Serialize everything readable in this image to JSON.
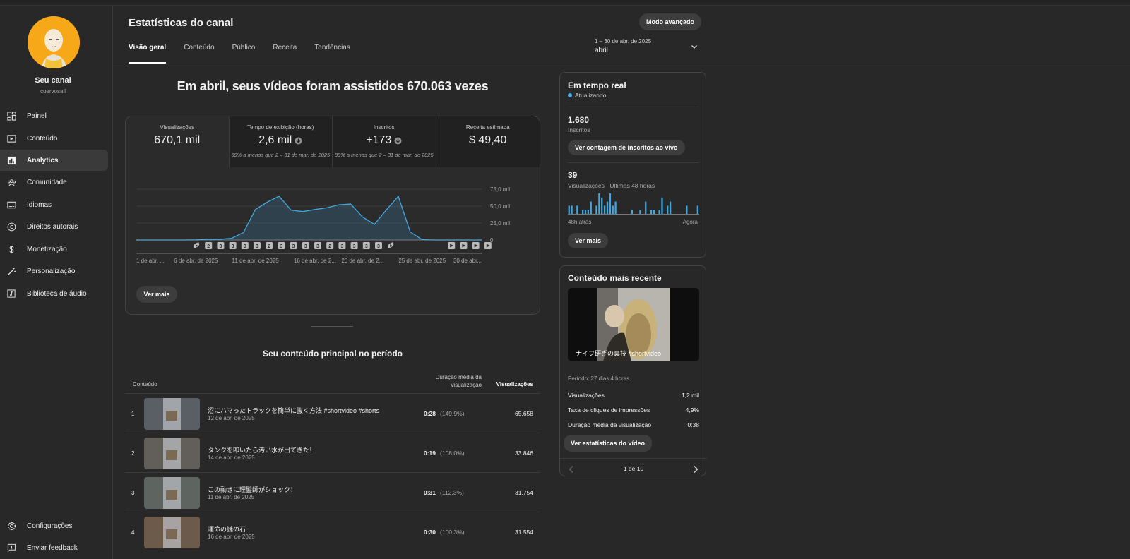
{
  "sidebar": {
    "channel_name": "Seu canal",
    "channel_handle": "cuervosail",
    "items": [
      {
        "label": "Painel",
        "icon": "dashboard-icon"
      },
      {
        "label": "Conteúdo",
        "icon": "content-icon"
      },
      {
        "label": "Analytics",
        "icon": "analytics-icon",
        "active": true
      },
      {
        "label": "Comunidade",
        "icon": "community-icon"
      },
      {
        "label": "Idiomas",
        "icon": "subtitles-icon"
      },
      {
        "label": "Direitos autorais",
        "icon": "copyright-icon"
      },
      {
        "label": "Monetização",
        "icon": "dollar-icon"
      },
      {
        "label": "Personalização",
        "icon": "magic-wand-icon"
      },
      {
        "label": "Biblioteca de áudio",
        "icon": "audio-library-icon"
      }
    ],
    "bottom_items": [
      {
        "label": "Configurações",
        "icon": "gear-icon"
      },
      {
        "label": "Enviar feedback",
        "icon": "feedback-icon"
      }
    ]
  },
  "header": {
    "title": "Estatísticas do canal",
    "advanced_button": "Modo avançado",
    "tabs": [
      "Visão geral",
      "Conteúdo",
      "Público",
      "Receita",
      "Tendências"
    ],
    "date_range": "1 – 30 de abr. de 2025",
    "date_value": "abril"
  },
  "overview": {
    "headline": "Em abril, seus vídeos foram assistidos 670.063 vezes",
    "metrics": [
      {
        "label": "Visualizações",
        "value": "670,1 mil",
        "sub": ""
      },
      {
        "label": "Tempo de exibição (horas)",
        "value": "2,6 mil",
        "sub": "69% a menos que 2 – 31 de mar. de 2025"
      },
      {
        "label": "Inscritos",
        "value": "+173",
        "sub": "89% a menos que 2 – 31 de mar. de 2025"
      },
      {
        "label": "Receita estimada",
        "value": "$ 49,40",
        "sub": ""
      }
    ],
    "ver_mais": "Ver mais"
  },
  "chart_data": {
    "type": "area",
    "x": [
      "1 abr",
      "2 abr",
      "3 abr",
      "4 abr",
      "5 abr",
      "6 abr",
      "7 abr",
      "8 abr",
      "9 abr",
      "10 abr",
      "11 abr",
      "12 abr",
      "13 abr",
      "14 abr",
      "15 abr",
      "16 abr",
      "17 abr",
      "18 abr",
      "19 abr",
      "20 abr",
      "21 abr",
      "22 abr",
      "23 abr",
      "24 abr",
      "25 abr",
      "26 abr",
      "27 abr",
      "28 abr",
      "29 abr",
      "30 abr"
    ],
    "values": [
      0,
      0,
      0,
      0,
      0,
      200,
      1300,
      1000,
      2500,
      11000,
      45000,
      56000,
      64500,
      44000,
      42000,
      45000,
      47500,
      52000,
      53000,
      34000,
      23000,
      44500,
      64500,
      12000,
      500,
      0,
      0,
      0,
      0,
      0
    ],
    "xtick_labels": [
      "1 de abr. ...",
      "6 de abr. de 2025",
      "11 de abr. de 2025",
      "16 de abr. de 2...",
      "20 de abr. de 2...",
      "25 de abr. de 2025",
      "30 de abr..."
    ],
    "xtick_index": [
      0,
      5,
      10,
      15,
      19,
      24,
      29
    ],
    "ytick_labels": [
      "75,0 mil",
      "50,0 mil",
      "25,0 mil",
      "0"
    ],
    "ylim": [
      0,
      75000
    ],
    "upload_markers": [
      "shorts",
      "2",
      "3",
      "3",
      "3",
      "3",
      "2",
      "3",
      "3",
      "3",
      "3",
      "2",
      "3",
      "3",
      "3",
      "3",
      "shorts",
      "",
      "",
      "",
      "",
      "video",
      "video",
      "video",
      "video"
    ],
    "color": "#41a9e1"
  },
  "top_content": {
    "title": "Seu conteúdo principal no período",
    "col_content": "Conteúdo",
    "col_duration": "Duração média da visualização",
    "col_views": "Visualizações",
    "rows": [
      {
        "rank": "1",
        "title": "沼にハマったトラックを簡単に抜く方法 #shortvideo #shorts",
        "date": "12 de abr. de 2025",
        "duration": "0:28",
        "pct": "(149,9%)",
        "views": "65.658",
        "thumb": "#5a5f66"
      },
      {
        "rank": "2",
        "title": "タンクを叩いたら汚い水が出てきた！",
        "date": "14 de abr. de 2025",
        "duration": "0:19",
        "pct": "(108,0%)",
        "views": "33.846",
        "thumb": "#625f5a"
      },
      {
        "rank": "3",
        "title": "この動きに理髪師がショック！",
        "date": "11 de abr. de 2025",
        "duration": "0:31",
        "pct": "(112,3%)",
        "views": "31.754",
        "thumb": "#5e6561"
      },
      {
        "rank": "4",
        "title": "運命の謎の石",
        "date": "16 de abr. de 2025",
        "duration": "0:30",
        "pct": "(100,3%)",
        "views": "31.554",
        "thumb": "#6c5a4a"
      }
    ]
  },
  "realtime": {
    "title": "Em tempo real",
    "status": "Atualizando",
    "subs_count": "1.680",
    "subs_label": "Inscritos",
    "subs_button": "Ver contagem de inscritos ao vivo",
    "views_count": "39",
    "views_label": "Visualizações · Últimas 48 horas",
    "bars": [
      2,
      2,
      0,
      2,
      0,
      1,
      1,
      1,
      3,
      0,
      2,
      5,
      4,
      2,
      3,
      5,
      2,
      3,
      0,
      0,
      0,
      0,
      0,
      1,
      0,
      0,
      1,
      0,
      3,
      0,
      1,
      1,
      0,
      1,
      4,
      0,
      2,
      3,
      0,
      0,
      0,
      0,
      0,
      2,
      0,
      0,
      0,
      2
    ],
    "axis_left": "48h atrás",
    "axis_right": "Agora",
    "more_button": "Ver mais"
  },
  "recent": {
    "title": "Conteúdo mais recente",
    "video_title": "ナイフ研ぎの裏技 #shortvideo",
    "period": "Período: 27 dias 4 horas",
    "stats": [
      {
        "label": "Visualizações",
        "value": "1,2 mil"
      },
      {
        "label": "Taxa de cliques de impressões",
        "value": "4,9%"
      },
      {
        "label": "Duração média da visualização",
        "value": "0:38"
      }
    ],
    "stats_button": "Ver estatísticas do vídeo",
    "pager": "1 de 10"
  }
}
